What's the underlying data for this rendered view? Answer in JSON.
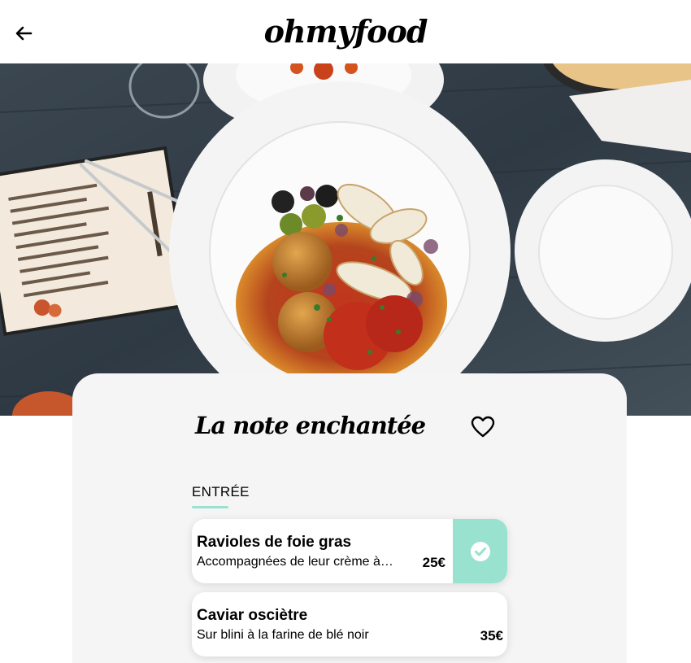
{
  "header": {
    "logo_text": "ohmyfood",
    "back_icon": "arrow-left-icon"
  },
  "restaurant": {
    "name": "La note enchantée",
    "favorite_icon": "heart-outline-icon"
  },
  "menu": {
    "section_label": "ENTRÉE",
    "dishes": [
      {
        "name": "Ravioles de foie gras",
        "description": "Accompagnées de leur crème à l'infusion de truffe",
        "price": "25€",
        "selected": true,
        "selected_icon": "check-circle-icon"
      },
      {
        "name": "Caviar osciètre",
        "description": "Sur blini à la farine de blé noir",
        "price": "35€",
        "selected": false
      }
    ]
  },
  "colors": {
    "accent": "#99e2d0",
    "card_background": "#f5f5f5"
  }
}
